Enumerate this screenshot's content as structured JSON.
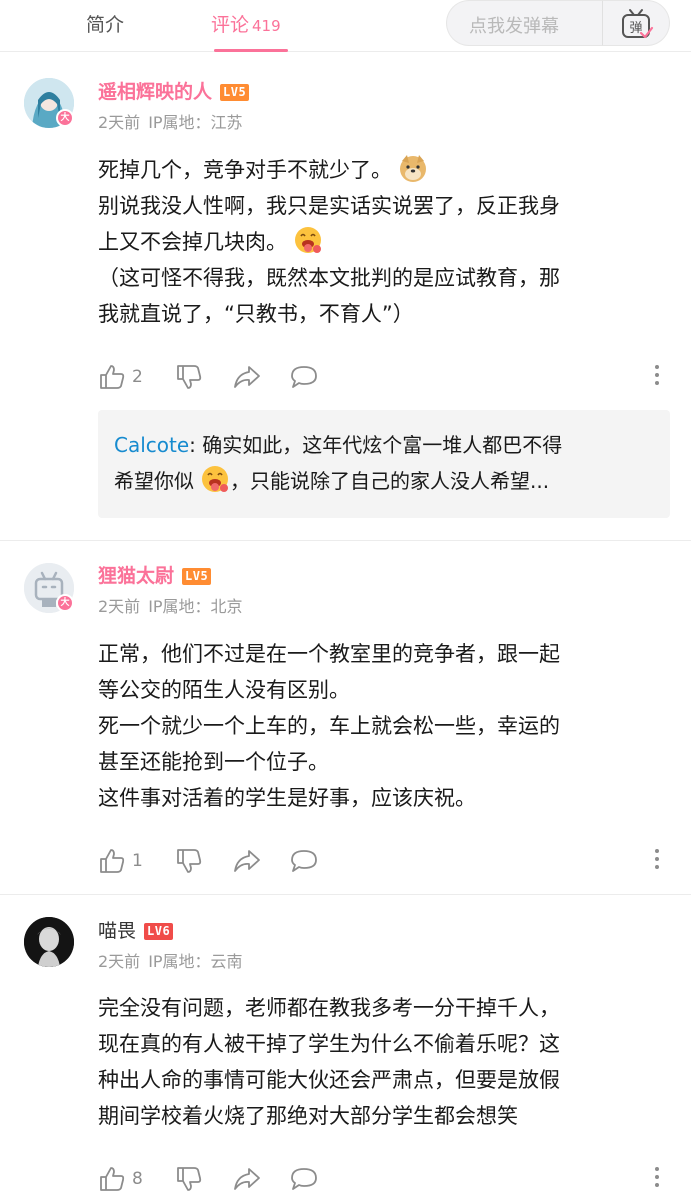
{
  "header": {
    "tab_intro": "简介",
    "tab_comments": "评论",
    "comment_count": "419",
    "danmaku_placeholder": "点我发弹幕",
    "danmaku_toggle_label": "弹",
    "accent_color": "#fb7299"
  },
  "comments": [
    {
      "username": "遥相辉映的人",
      "level": "LV5",
      "time": "2天前",
      "ip": "IP属地：江苏",
      "badge": "大",
      "lines": [
        "死掉几个，竞争对手不就少了。",
        "别说我没人性啊，我只是实话实说罢了，反正我身",
        "上又不会掉几块肉。",
        "（这可怪不得我，既然本文批判的是应试教育，那",
        "我就直说了，“只教书，不育人”）"
      ],
      "likes": "2",
      "reply": {
        "user": "Calcote",
        "line1": ": 确实如此，这年代炫个富一堆人都巴不得",
        "line2a": "希望你似",
        "line2b": "，只能说除了自己的家人没人希望..."
      }
    },
    {
      "username": "狸猫太尉",
      "level": "LV5",
      "time": "2天前",
      "ip": "IP属地：北京",
      "badge": "大",
      "lines": [
        "正常，他们不过是在一个教室里的竞争者，跟一起",
        "等公交的陌生人没有区别。",
        "死一个就少一个上车的，车上就会松一些，幸运的",
        "甚至还能抢到一个位子。",
        "这件事对活着的学生是好事，应该庆祝。"
      ],
      "likes": "1"
    },
    {
      "username": "喵畏",
      "level": "LV6",
      "time": "2天前",
      "ip": "IP属地：云南",
      "lines": [
        "完全没有问题，老师都在教我多考一分干掉千人，",
        "现在真的有人被干掉了学生为什么不偷着乐呢？这",
        "种出人命的事情可能大伙还会严肃点，但要是放假",
        "期间学校着火烧了那绝对大部分学生都会想笑"
      ],
      "likes": "8"
    }
  ],
  "icons": [
    "like-icon",
    "dislike-icon",
    "share-icon",
    "reply-icon",
    "more-icon",
    "doge-emoji",
    "tongue-emoji",
    "danmaku-tv-icon"
  ]
}
